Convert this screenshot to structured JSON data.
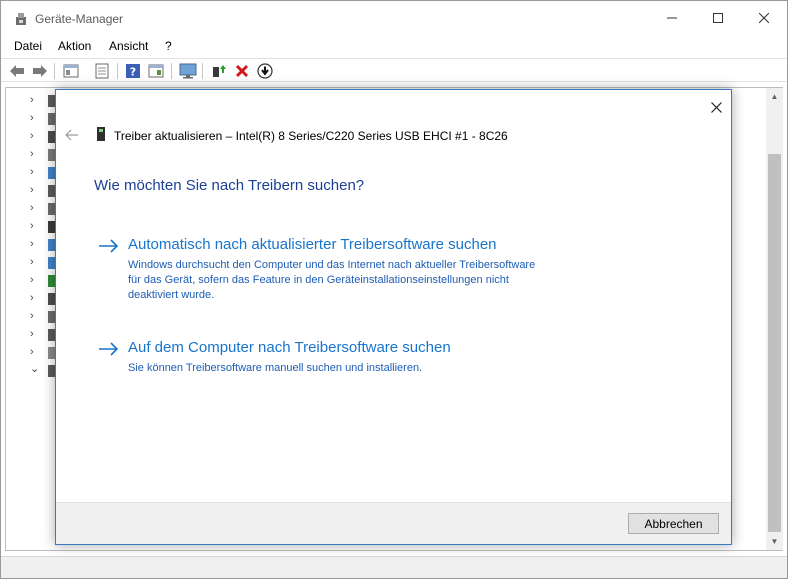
{
  "window": {
    "title": "Geräte-Manager",
    "icon": "device-manager-icon"
  },
  "menu": {
    "items": [
      "Datei",
      "Aktion",
      "Ansicht",
      "?"
    ]
  },
  "toolbar": {
    "buttons": [
      "back-arrow-icon",
      "forward-arrow-icon",
      "show-hide-tree-icon",
      "properties-icon",
      "help-icon",
      "view-icon",
      "monitor-scan-icon",
      "update-driver-icon",
      "uninstall-x-icon",
      "disable-device-icon"
    ]
  },
  "dialog": {
    "title": "Treiber aktualisieren – Intel(R) 8 Series/C220 Series USB EHCI #1 - 8C26",
    "heading": "Wie möchten Sie nach Treibern suchen?",
    "options": [
      {
        "title": "Automatisch nach aktualisierter Treibersoftware suchen",
        "description": "Windows durchsucht den Computer und das Internet nach aktueller Treibersoftware für das Gerät, sofern das Feature in den Geräteinstallationseinstellungen nicht deaktiviert wurde."
      },
      {
        "title": "Auf dem Computer nach Treibersoftware suchen",
        "description": "Sie können Treibersoftware manuell suchen und installieren."
      }
    ],
    "cancel_label": "Abbrechen"
  },
  "colors": {
    "heading": "#1b3f95",
    "link": "#1874cd",
    "dialog_border": "#3a78c3"
  }
}
